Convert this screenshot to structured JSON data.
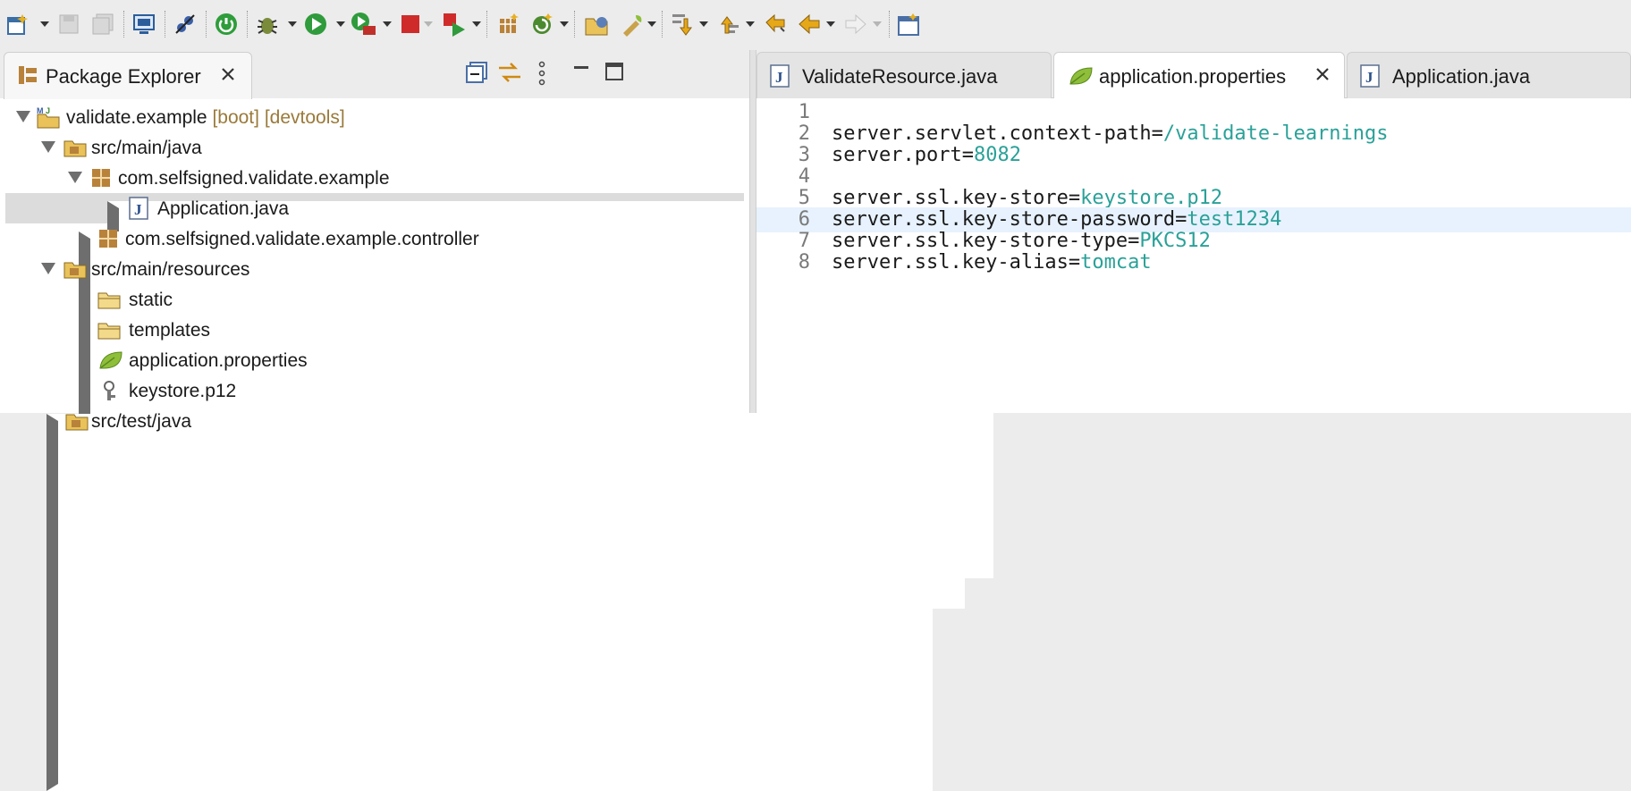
{
  "toolbar": {
    "buttons": [
      "new-wizard",
      "save",
      "save-all",
      "open-console",
      "skip-breakpoints",
      "spring-boot-dashboard",
      "debug",
      "run",
      "run-server",
      "terminate",
      "run-last",
      "open-type",
      "refresh-run",
      "open-project",
      "spring-tool",
      "next-annotation",
      "previous-annotation",
      "last-edit-location",
      "back",
      "forward",
      "open-perspective"
    ]
  },
  "left": {
    "view_title": "Package Explorer",
    "tree": [
      {
        "label": "validate.example",
        "decoration": "[boot] [devtools]"
      },
      {
        "label": "src/main/java"
      },
      {
        "label": "com.selfsigned.validate.example"
      },
      {
        "label": "Application.java"
      },
      {
        "label": "com.selfsigned.validate.example.controller"
      },
      {
        "label": "src/main/resources"
      },
      {
        "label": "static"
      },
      {
        "label": "templates"
      },
      {
        "label": "application.properties"
      },
      {
        "label": "keystore.p12"
      },
      {
        "label": "src/test/java"
      }
    ]
  },
  "editor": {
    "tabs": [
      {
        "label": "ValidateResource.java"
      },
      {
        "label": "application.properties"
      },
      {
        "label": "Application.java"
      }
    ],
    "lines": [
      {
        "num": "1",
        "key": "",
        "value": ""
      },
      {
        "num": "2",
        "key": "server.servlet.context-path=",
        "value": "/validate-learnings"
      },
      {
        "num": "3",
        "key": "server.port=",
        "value": "8082"
      },
      {
        "num": "4",
        "key": "",
        "value": ""
      },
      {
        "num": "5",
        "key": "server.ssl.key-store=",
        "value": "keystore.p12"
      },
      {
        "num": "6",
        "key": "server.ssl.key-store-password=",
        "value": "test1234"
      },
      {
        "num": "7",
        "key": "server.ssl.key-store-type=",
        "value": "PKCS12"
      },
      {
        "num": "8",
        "key": "server.ssl.key-alias=",
        "value": "tomcat"
      }
    ]
  },
  "colors": {
    "value": "#2aa198",
    "decoration": "#9a7a3a",
    "current_line": "#e8f2fe",
    "selection": "#dcdcdc"
  }
}
